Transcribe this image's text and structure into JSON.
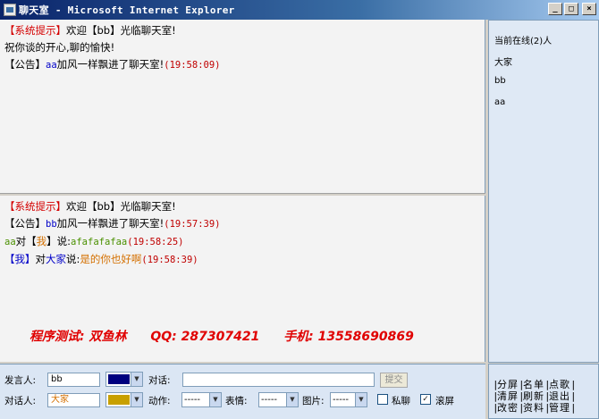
{
  "window": {
    "title": "聊天室 - Microsoft Internet Explorer",
    "minimize": "_",
    "maximize": "□",
    "close": "×"
  },
  "public_messages": [
    {
      "parts": [
        {
          "t": "【系统提示】",
          "c": "red"
        },
        {
          "t": "欢迎【bb】光临聊天室!",
          "c": ""
        }
      ]
    },
    {
      "parts": [
        {
          "t": "祝你谈的开心,聊的愉快!",
          "c": ""
        }
      ]
    },
    {
      "parts": [
        {
          "t": "【公告】",
          "c": ""
        },
        {
          "t": "aa",
          "c": "blue mono"
        },
        {
          "t": "加风一样飘进了聊天室!",
          "c": ""
        },
        {
          "t": "(19:58:09)",
          "c": "time mono"
        }
      ]
    }
  ],
  "private_messages": [
    {
      "parts": [
        {
          "t": "【系统提示】",
          "c": "red"
        },
        {
          "t": "欢迎【bb】光临聊天室!",
          "c": ""
        }
      ]
    },
    {
      "parts": [
        {
          "t": "【公告】",
          "c": ""
        },
        {
          "t": "bb",
          "c": "blue mono"
        },
        {
          "t": "加风一样飘进了聊天室!",
          "c": ""
        },
        {
          "t": "(19:57:39)",
          "c": "time mono"
        }
      ]
    },
    {
      "parts": [
        {
          "t": "aa",
          "c": "green mono"
        },
        {
          "t": "对【",
          "c": ""
        },
        {
          "t": "我",
          "c": "orange"
        },
        {
          "t": "】说:",
          "c": ""
        },
        {
          "t": "afafafafaa",
          "c": "green mono"
        },
        {
          "t": "(19:58:25)",
          "c": "time mono"
        }
      ]
    },
    {
      "parts": [
        {
          "t": "【我】",
          "c": "blue"
        },
        {
          "t": "对",
          "c": ""
        },
        {
          "t": "大家",
          "c": "blue"
        },
        {
          "t": "说:",
          "c": ""
        },
        {
          "t": "是的你也好啊",
          "c": "orange"
        },
        {
          "t": "(19:58:39)",
          "c": "time mono"
        }
      ]
    }
  ],
  "online": {
    "count_label": "当前在线(2)人",
    "users": [
      "大家",
      "bb",
      "aa"
    ]
  },
  "credit": {
    "tester": "程序测试: 双鱼林",
    "qq": "QQ: 287307421",
    "phone": "手机: 13558690869"
  },
  "controls": {
    "speaker_label": "发言人:",
    "speaker_value": "bb",
    "speaker_color": "#00007f",
    "target_label": "对话人:",
    "target_value": "大家",
    "target_color": "#c8a000",
    "message_label": "对话:",
    "message_value": "",
    "submit_label": "提交",
    "action_label": "动作:",
    "action_value": "-----",
    "emotion_label": "表情:",
    "emotion_value": "-----",
    "image_label": "图片:",
    "image_value": "-----",
    "private_label": "私聊",
    "private_checked": false,
    "scroll_label": "滚屏",
    "scroll_checked": true
  },
  "commands": [
    [
      "分屏",
      "名单",
      "点歌"
    ],
    [
      "清屏",
      "刷新",
      "退出"
    ],
    [
      "改密",
      "资料",
      "管理"
    ]
  ]
}
